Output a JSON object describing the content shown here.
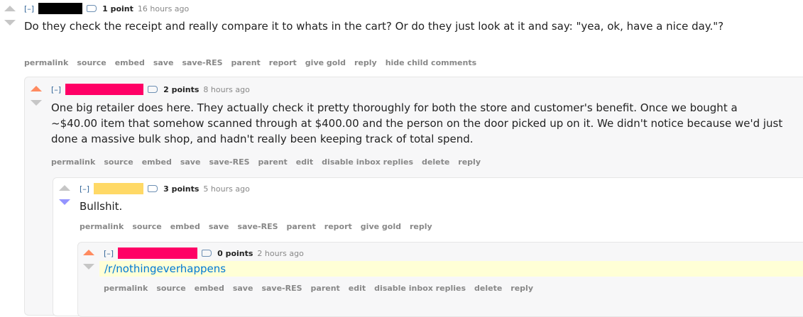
{
  "comments": [
    {
      "expand": "[–]",
      "username_redact_color": "#000000",
      "score": "1 point",
      "time": "16 hours ago",
      "body": "Do they check the receipt and really compare it to whats in the cart? Or do they just look at it and say: \"yea, ok, have a nice day.\"?",
      "buttons": [
        "permalink",
        "source",
        "embed",
        "save",
        "save-RES",
        "parent",
        "report",
        "give gold",
        "reply",
        "hide child comments"
      ]
    },
    {
      "expand": "[–]",
      "username_redact_color": "#ff0066",
      "score": "2 points",
      "time": "8 hours ago",
      "body": "One big retailer does here. They actually check it pretty thoroughly for both the store and customer's benefit. Once we bought a ~$40.00 item that somehow scanned through at $400.00 and the person on the door picked up on it. We didn't notice because we'd just done a massive bulk shop, and hadn't really been keeping track of total spend.",
      "buttons": [
        "permalink",
        "source",
        "embed",
        "save",
        "save-RES",
        "parent",
        "edit",
        "disable inbox replies",
        "delete",
        "reply"
      ]
    },
    {
      "expand": "[–]",
      "username_redact_color": "#ffd966",
      "score": "3 points",
      "time": "5 hours ago",
      "body": "Bullshit.",
      "buttons": [
        "permalink",
        "source",
        "embed",
        "save",
        "save-RES",
        "parent",
        "report",
        "give gold",
        "reply"
      ]
    },
    {
      "expand": "[–]",
      "username_redact_color": "#ff0066",
      "score": "0 points",
      "time": "2 hours ago",
      "body": "/r/nothingeverhappens",
      "buttons": [
        "permalink",
        "source",
        "embed",
        "save",
        "save-RES",
        "parent",
        "edit",
        "disable inbox replies",
        "delete",
        "reply"
      ]
    }
  ],
  "colors": {
    "upvoted": "#ff8b60",
    "downvoted": "#9494ff",
    "neutral": "#c6c6c6"
  }
}
